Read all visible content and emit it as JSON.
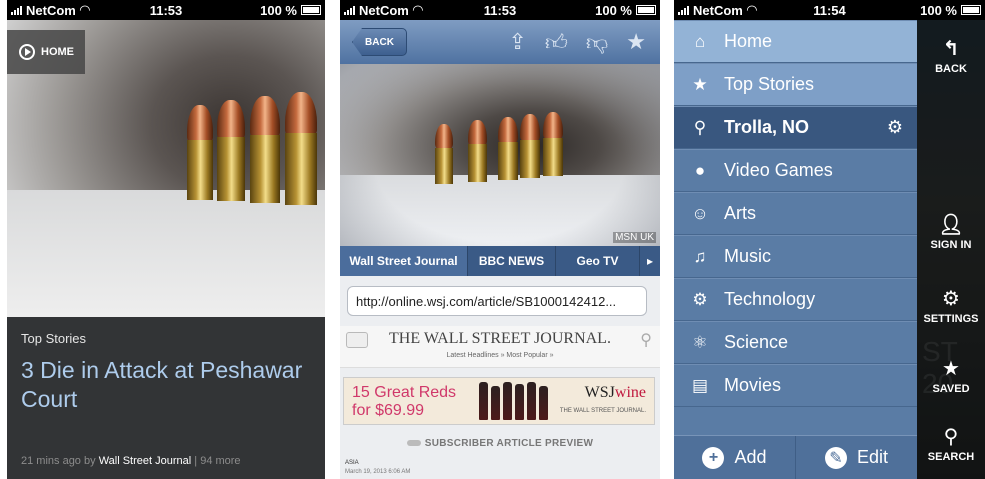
{
  "status": {
    "carrier": "NetCom",
    "time_1": "11:53",
    "time_2": "11:53",
    "time_3": "11:54",
    "battery": "100 %"
  },
  "screen1": {
    "home_label": "HOME",
    "category": "Top Stories",
    "headline": "3 Die in Attack at Peshawar Court",
    "meta_time": "21 mins ago",
    "meta_by": "by",
    "meta_source": "Wall Street Journal",
    "meta_more": "| 94 more"
  },
  "screen2": {
    "back_label": "BACK",
    "photo_credit": "MSN UK",
    "tabs": [
      "Wall Street Journal",
      "BBC NEWS",
      "Geo TV"
    ],
    "url": "http://online.wsj.com/article/SB1000142412...",
    "wsj_logo": "THE WALL STREET JOURNAL.",
    "wsj_sub": "Latest Headlines »    Most Popular »",
    "ad_line1": "15 Great Reds",
    "ad_line2": "for $69.99",
    "ad_brand_a": "WSJ",
    "ad_brand_b": "wine",
    "ad_brand_sub": "THE WALL STREET JOURNAL.",
    "preview_label": "SUBSCRIBER ARTICLE PREVIEW",
    "section": "ASIA",
    "date": "March 19, 2013 6:06 AM"
  },
  "screen3": {
    "menu": [
      {
        "label": "Home",
        "icon": "house-icon"
      },
      {
        "label": "Top Stories",
        "icon": "star-icon"
      },
      {
        "label": "Trolla, NO",
        "icon": "location-pin-icon"
      },
      {
        "label": "Video Games",
        "icon": "gamepad-icon"
      },
      {
        "label": "Arts",
        "icon": "theater-masks-icon"
      },
      {
        "label": "Music",
        "icon": "music-note-icon"
      },
      {
        "label": "Technology",
        "icon": "gears-icon"
      },
      {
        "label": "Science",
        "icon": "atom-icon"
      },
      {
        "label": "Movies",
        "icon": "clapperboard-icon"
      }
    ],
    "add_label": "Add",
    "edit_label": "Edit",
    "side": {
      "back": "BACK",
      "sign_in": "SIGN IN",
      "settings": "SETTINGS",
      "saved": "SAVED",
      "search": "SEARCH"
    }
  },
  "colors": {
    "nav_blue": "#5a7ca5",
    "active_blue": "#39577f",
    "headline_blue": "#aeccec",
    "ad_red": "#d0386a"
  }
}
